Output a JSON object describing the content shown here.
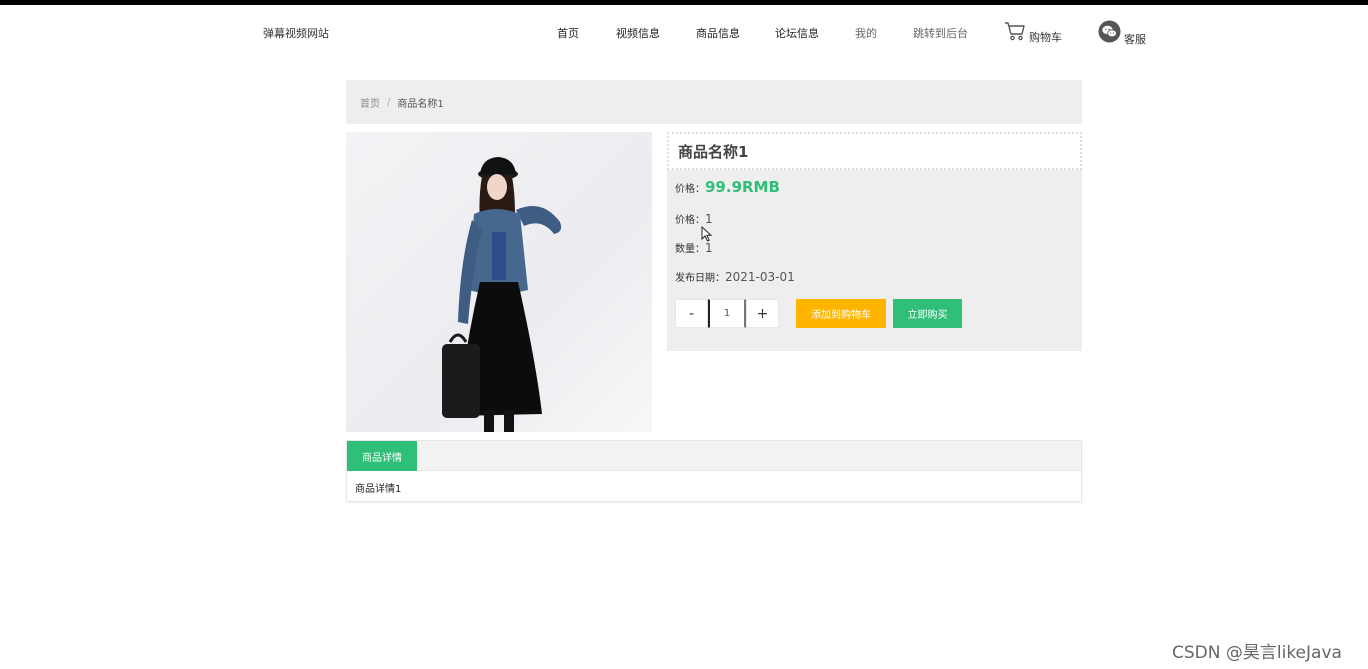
{
  "header": {
    "site_title": "弹幕视频网站",
    "nav": {
      "home": "首页",
      "video": "视频信息",
      "goods": "商品信息",
      "forum": "论坛信息",
      "mine": "我的",
      "admin": "跳转到后台",
      "cart": "购物车",
      "service": "客服"
    },
    "icons": {
      "cart": "cart-icon",
      "service": "wechat-icon"
    }
  },
  "breadcrumb": {
    "home": "首页",
    "separator": "/",
    "current": "商品名称1"
  },
  "product": {
    "name": "商品名称1",
    "price_label": "价格：",
    "price_value": "99.9RMB",
    "price2_label": "价格：",
    "price2_value": "1",
    "qty_label": "数量：",
    "qty_value": "1",
    "date_label": "发布日期：",
    "date_value": "2021-03-01",
    "stepper": {
      "minus": "-",
      "value": "1",
      "plus": "+"
    },
    "add_to_cart": "添加到购物车",
    "buy_now": "立即购买"
  },
  "detail": {
    "tab_label": "商品详情",
    "content": "商品详情1"
  },
  "watermark": "CSDN @昊言likeJava",
  "colors": {
    "accent_green": "#2fbf78",
    "accent_orange": "#ffb400",
    "panel_gray": "#eeeeee"
  }
}
